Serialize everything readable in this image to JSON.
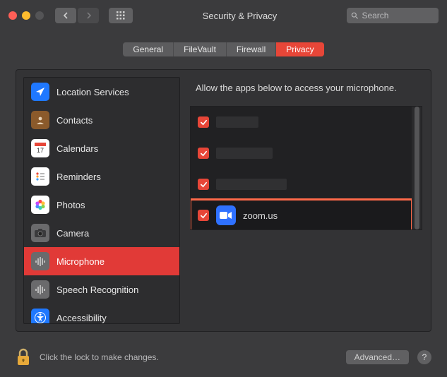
{
  "window": {
    "title": "Security & Privacy",
    "search_placeholder": "Search"
  },
  "tabs": [
    {
      "label": "General",
      "active": false
    },
    {
      "label": "FileVault",
      "active": false
    },
    {
      "label": "Firewall",
      "active": false
    },
    {
      "label": "Privacy",
      "active": true
    }
  ],
  "sidebar": {
    "items": [
      {
        "key": "location",
        "label": "Location Services",
        "selected": false,
        "icon": "location",
        "bg": "#1f78ff"
      },
      {
        "key": "contacts",
        "label": "Contacts",
        "selected": false,
        "icon": "contacts",
        "bg": "#8b5a2b"
      },
      {
        "key": "calendars",
        "label": "Calendars",
        "selected": false,
        "icon": "calendar",
        "bg": "#ffffff"
      },
      {
        "key": "reminders",
        "label": "Reminders",
        "selected": false,
        "icon": "reminders",
        "bg": "#ffffff"
      },
      {
        "key": "photos",
        "label": "Photos",
        "selected": false,
        "icon": "photos",
        "bg": "#ffffff"
      },
      {
        "key": "camera",
        "label": "Camera",
        "selected": false,
        "icon": "camera",
        "bg": "#6a6a6c"
      },
      {
        "key": "microphone",
        "label": "Microphone",
        "selected": true,
        "icon": "microphone",
        "bg": "#6a6a6c"
      },
      {
        "key": "speech",
        "label": "Speech Recognition",
        "selected": false,
        "icon": "microphone",
        "bg": "#6a6a6c"
      },
      {
        "key": "accessibility",
        "label": "Accessibility",
        "selected": false,
        "icon": "accessibility",
        "bg": "#1f78ff"
      }
    ]
  },
  "right": {
    "caption": "Allow the apps below to access your microphone.",
    "apps": [
      {
        "checked": true,
        "name": "",
        "redacted": true,
        "highlight": false
      },
      {
        "checked": true,
        "name": "",
        "redacted": true,
        "highlight": false
      },
      {
        "checked": true,
        "name": "",
        "redacted": true,
        "highlight": false
      },
      {
        "checked": true,
        "name": "zoom.us",
        "redacted": false,
        "highlight": true,
        "icon_bg": "#2f71ff"
      }
    ]
  },
  "footer": {
    "lock_text": "Click the lock to make changes.",
    "advanced_label": "Advanced…",
    "help_label": "?"
  }
}
